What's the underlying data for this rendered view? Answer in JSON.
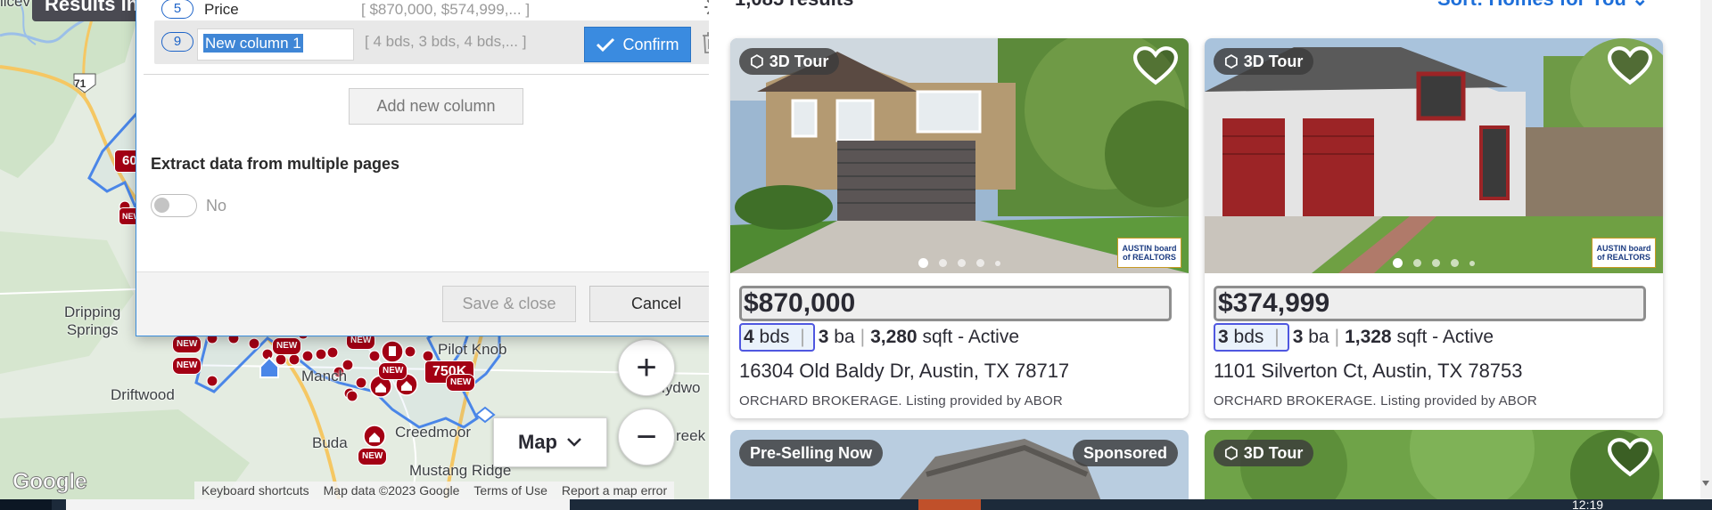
{
  "map": {
    "results_tab": "Results in",
    "road_number": "71",
    "labels": {
      "dripping_springs": "Dripping\nSprings",
      "driftwood": "Driftwood",
      "buda": "Buda",
      "creedmoor": "Creedmoor",
      "mustang_ridge": "Mustang Ridge",
      "pilot_knob": "Pilot Knob",
      "manchaca": "Manch",
      "elroy": "lydwo",
      "creek": "reek",
      "top_left": "licev"
    },
    "pins": {
      "p60": "60",
      "p750k": "750K"
    },
    "new_badge": "NEW",
    "map_type_label": "Map",
    "zoom_in": "+",
    "zoom_out": "−",
    "google_logo": "Google",
    "attribution": {
      "shortcuts": "Keyboard shortcuts",
      "data": "Map data ©2023 Google",
      "terms": "Terms of Use",
      "report": "Report a map error"
    }
  },
  "dialog": {
    "row_price": {
      "number": "5",
      "name": "Price",
      "sample": "[ $870,000, $574,999,... ]"
    },
    "row_new": {
      "number": "9",
      "name": "New column 1",
      "sample": "[ 4 bds, 3 bds, 4 bds,... ]",
      "confirm_label": "Confirm"
    },
    "add_column_label": "Add new column",
    "extract_label": "Extract data from multiple pages",
    "toggle_value": "No",
    "save_close_label": "Save & close",
    "cancel_label": "Cancel"
  },
  "results": {
    "count_text": "1,085 results",
    "sort_label": "Sort: Homes for You",
    "cards": [
      {
        "badge": "3D Tour",
        "price": "$870,000",
        "beds": "4",
        "beds_unit": "bds",
        "baths": "3",
        "baths_unit": "ba",
        "sqft": "3,280",
        "sqft_unit": "sqft",
        "status": "- Active",
        "address": "16304 Old Baldy Dr, Austin, TX 78717",
        "broker": "ORCHARD BROKERAGE. Listing provided by ABOR",
        "board_logo": "AUSTIN board of REALTORS"
      },
      {
        "badge": "3D Tour",
        "price": "$374,999",
        "beds": "3",
        "beds_unit": "bds",
        "baths": "3",
        "baths_unit": "ba",
        "sqft": "1,328",
        "sqft_unit": "sqft",
        "status": "- Active",
        "address": "1101 Silverton Ct, Austin, TX 78753",
        "broker": "ORCHARD BROKERAGE. Listing provided by ABOR",
        "board_logo": "AUSTIN board of REALTORS"
      },
      {
        "badge": "Pre-Selling Now",
        "sponsored": "Sponsored"
      },
      {
        "badge": "3D Tour"
      }
    ]
  },
  "taskbar": {
    "clock": "12:19"
  },
  "colors": {
    "accent_blue": "#3a8be0",
    "map_pin_red": "#a30014",
    "boundary_blue": "#4a86e8",
    "highlight_box": "#4f57e0"
  }
}
